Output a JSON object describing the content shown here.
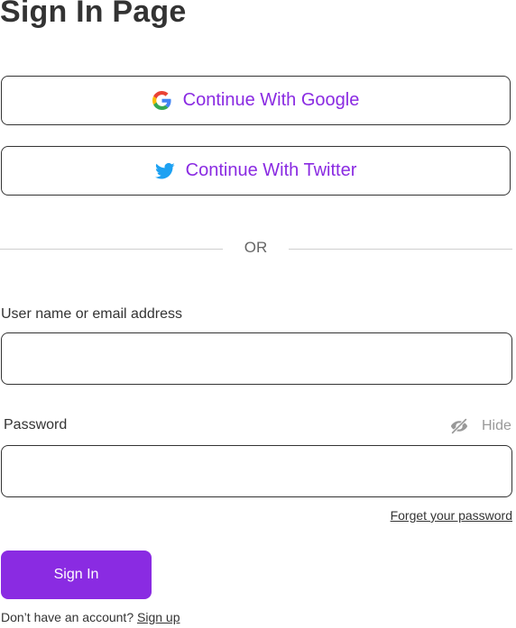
{
  "page": {
    "title": "Sign In Page"
  },
  "social": {
    "google_label": "Continue With Google",
    "twitter_label": "Continue With Twitter",
    "google_icon": "google-icon",
    "twitter_icon": "twitter-icon"
  },
  "divider": {
    "text": "OR"
  },
  "form": {
    "username_label": "User name or email address",
    "username_value": "",
    "password_label": "Password",
    "password_value": "",
    "hide_label": "Hide",
    "hide_icon": "eye-slash-icon",
    "forgot_label": "Forget your password",
    "submit_label": "Sign In"
  },
  "footer": {
    "prompt": "Don’t have an account?",
    "signup_label": "Sign up"
  },
  "colors": {
    "accent": "#8a2be2",
    "text": "#333333",
    "muted": "#999999",
    "divider": "#cfcfcf",
    "twitter": "#1da1f2"
  }
}
